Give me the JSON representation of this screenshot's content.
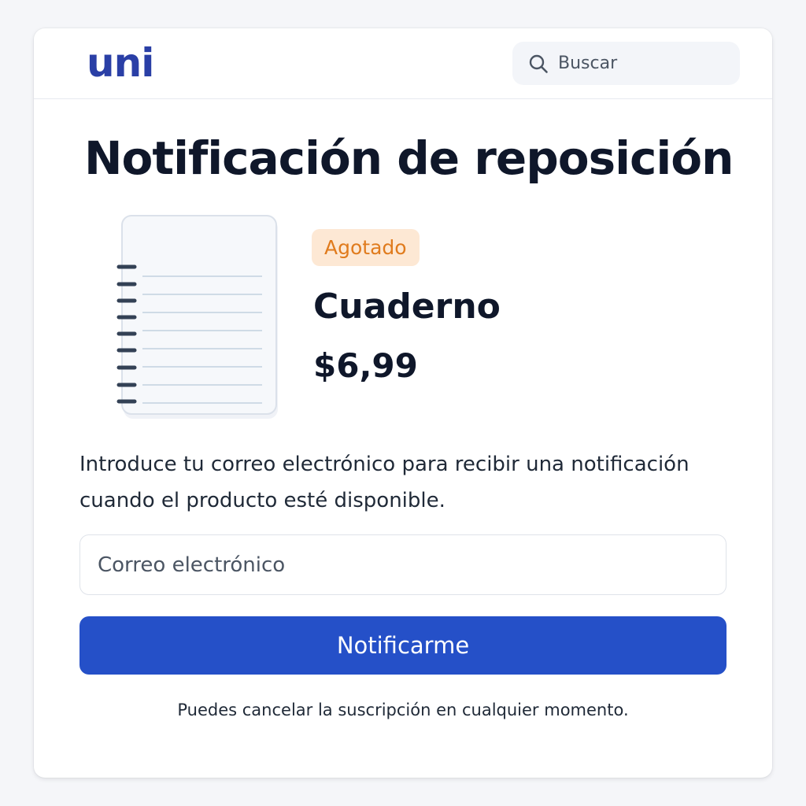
{
  "brand": {
    "logo_text": "uni",
    "accent_color": "#2a3fa6"
  },
  "search": {
    "placeholder": "Buscar",
    "icon": "search-icon"
  },
  "page": {
    "title": "Notificación de reposición"
  },
  "product": {
    "image_icon": "spiral-notebook",
    "status_badge": "Agotado",
    "status_color": "#e07b1d",
    "name": "Cuaderno",
    "price": "$6,99"
  },
  "form": {
    "description": "Introduce tu correo electrónico para recibir una notificación cuando el producto esté disponible.",
    "email_placeholder": "Correo electrónico",
    "submit_label": "Notificarme",
    "submit_color": "#2550c8",
    "footnote": "Puedes cancelar la suscripción en cualquier momento."
  }
}
